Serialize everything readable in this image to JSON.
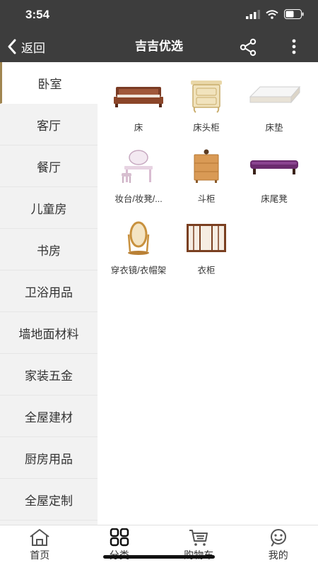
{
  "status_bar": {
    "time": "3:54"
  },
  "nav": {
    "back_label": "返回",
    "title": "吉吉优选"
  },
  "sidebar": {
    "items": [
      {
        "label": "卧室",
        "active": true
      },
      {
        "label": "客厅"
      },
      {
        "label": "餐厅"
      },
      {
        "label": "儿童房"
      },
      {
        "label": "书房"
      },
      {
        "label": "卫浴用品"
      },
      {
        "label": "墙地面材料"
      },
      {
        "label": "家装五金"
      },
      {
        "label": "全屋建材"
      },
      {
        "label": "厨房用品"
      },
      {
        "label": "全屋定制"
      }
    ]
  },
  "products": [
    {
      "label": "床",
      "icon": "bed-image"
    },
    {
      "label": "床头柜",
      "icon": "nightstand-image"
    },
    {
      "label": "床垫",
      "icon": "mattress-image"
    },
    {
      "label": "妆台/妆凳/...",
      "icon": "vanity-table-image"
    },
    {
      "label": "斗柜",
      "icon": "chest-of-drawers-image"
    },
    {
      "label": "床尾凳",
      "icon": "bench-image"
    },
    {
      "label": "穿衣镜/衣帽架",
      "icon": "floor-mirror-image"
    },
    {
      "label": "衣柜",
      "icon": "wardrobe-image"
    }
  ],
  "tabbar": {
    "tabs": [
      {
        "label": "首页",
        "icon": "home-icon"
      },
      {
        "label": "分类",
        "icon": "category-icon",
        "active": true
      },
      {
        "label": "购物车",
        "icon": "cart-icon"
      },
      {
        "label": "我的",
        "icon": "profile-icon"
      }
    ]
  },
  "colors": {
    "header": "#3d3d3d",
    "accent": "#a08550",
    "sidebar_bg": "#f2f2f2"
  }
}
